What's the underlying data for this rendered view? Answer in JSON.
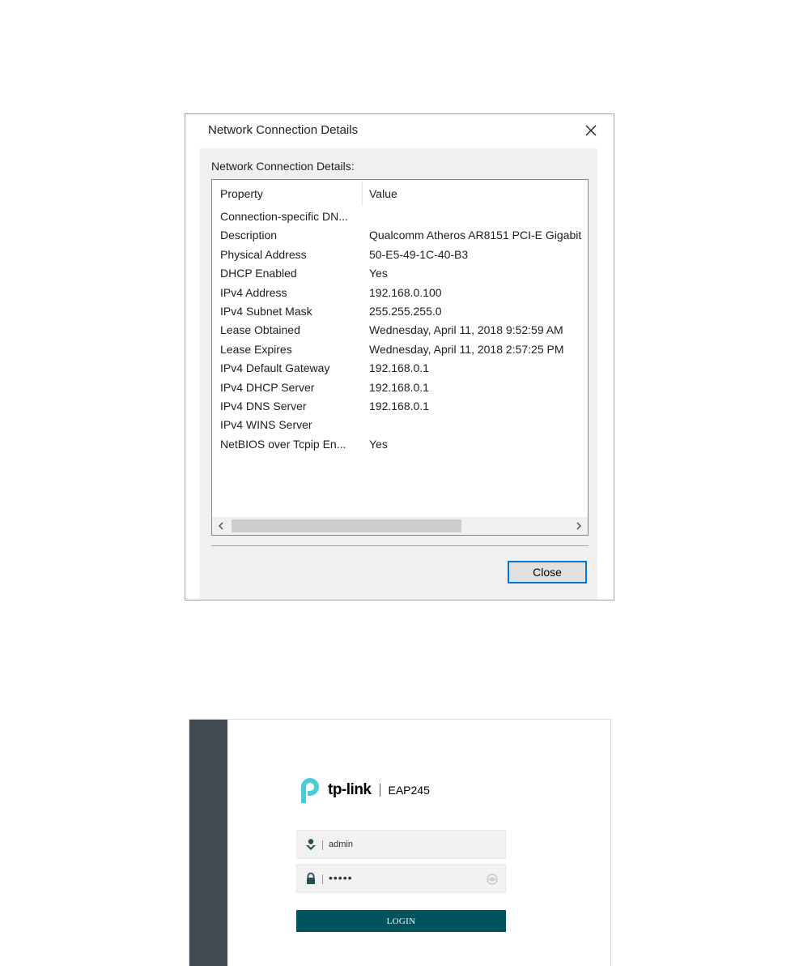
{
  "dialog": {
    "title": "Network Connection Details",
    "group_label": "Network Connection Details:",
    "columns": {
      "property": "Property",
      "value": "Value"
    },
    "rows": [
      {
        "property": "Connection-specific DN...",
        "value": ""
      },
      {
        "property": "Description",
        "value": "Qualcomm Atheros AR8151 PCI-E Gigabit"
      },
      {
        "property": "Physical Address",
        "value": "50-E5-49-1C-40-B3"
      },
      {
        "property": "DHCP Enabled",
        "value": "Yes"
      },
      {
        "property": "IPv4 Address",
        "value": "192.168.0.100"
      },
      {
        "property": "IPv4 Subnet Mask",
        "value": "255.255.255.0"
      },
      {
        "property": "Lease Obtained",
        "value": "Wednesday, April 11, 2018 9:52:59 AM"
      },
      {
        "property": "Lease Expires",
        "value": "Wednesday, April 11, 2018 2:57:25 PM"
      },
      {
        "property": "IPv4 Default Gateway",
        "value": "192.168.0.1"
      },
      {
        "property": "IPv4 DHCP Server",
        "value": "192.168.0.1"
      },
      {
        "property": "IPv4 DNS Server",
        "value": "192.168.0.1"
      },
      {
        "property": "IPv4 WINS Server",
        "value": ""
      },
      {
        "property": "NetBIOS over Tcpip En...",
        "value": "Yes"
      }
    ],
    "close_label": "Close"
  },
  "login": {
    "brand": "tp-link",
    "model": "EAP245",
    "username_value": "admin",
    "password_mask": "•••••",
    "button_label": "LOGIN",
    "colors": {
      "sidebar": "#434a52",
      "accent": "#00525d",
      "logo": "#4acbd6"
    },
    "icons": {
      "user": "user-icon",
      "lock": "lock-icon",
      "eye": "eye-icon"
    }
  }
}
